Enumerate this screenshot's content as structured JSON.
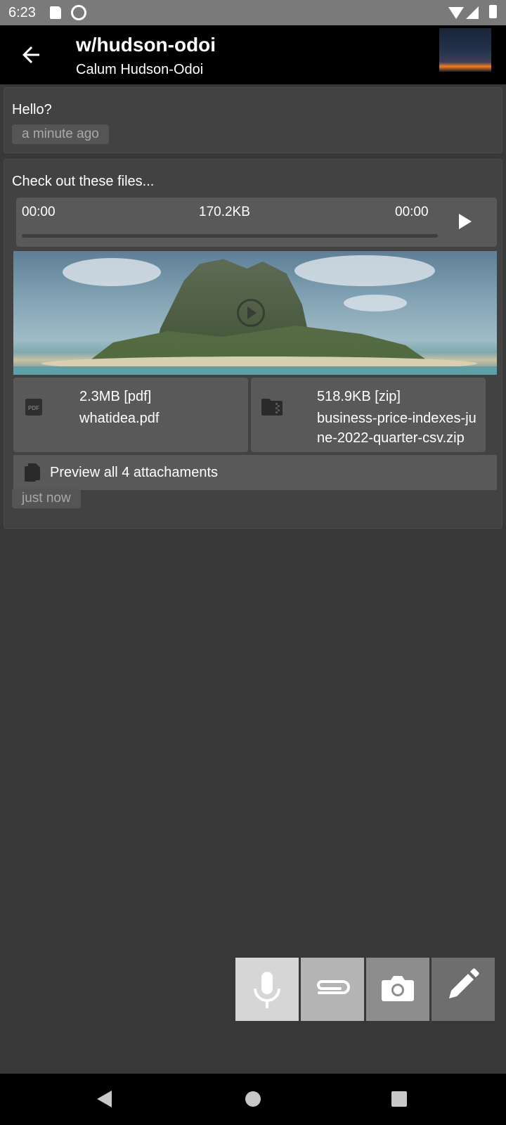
{
  "status_bar": {
    "time": "6:23"
  },
  "header": {
    "title": "w/hudson-odoi",
    "subtitle": "Calum Hudson-Odoi"
  },
  "messages": [
    {
      "text": "Hello?",
      "time": "a minute ago"
    },
    {
      "text": "Check out these files...",
      "audio": {
        "elapsed": "00:00",
        "size": "170.2KB",
        "duration": "00:00"
      },
      "files": [
        {
          "size": "2.3MB [pdf]",
          "name": "whatidea.pdf",
          "icon": "pdf-icon"
        },
        {
          "size": "518.9KB [zip]",
          "name": "business-price-indexes-june-2022-quarter-csv.zip",
          "icon": "zip-folder-icon"
        }
      ],
      "preview_label": "Preview all 4 attachaments",
      "time": "just now"
    }
  ],
  "actions": [
    "mic-icon",
    "attach-icon",
    "camera-icon",
    "edit-icon"
  ]
}
